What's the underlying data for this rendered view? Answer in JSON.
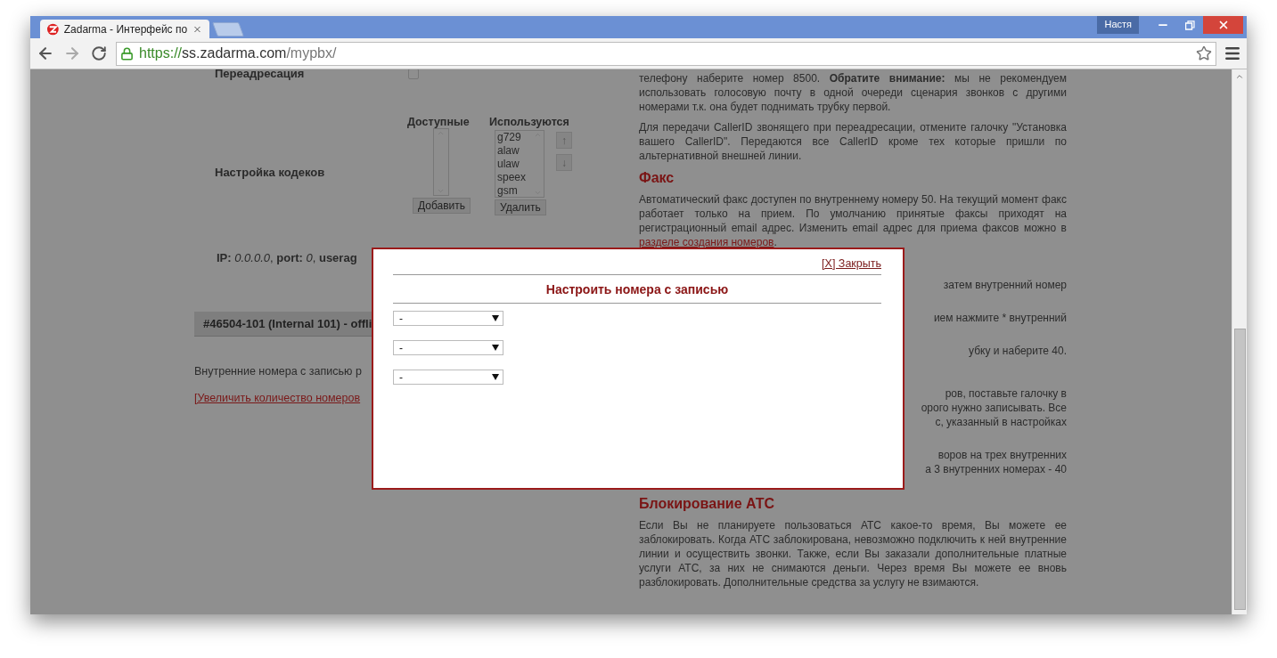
{
  "browser": {
    "tab_title": "Zadarma - Интерфейс по",
    "url_scheme": "https://",
    "url_host": "ss.zadarma.com",
    "url_path": "/mypbx/",
    "profile": "Настя"
  },
  "left": {
    "forwarding": {
      "label": "Переадресация",
      "checked": false
    },
    "codecs": {
      "label": "Настройка кодеков",
      "available_header": "Доступные",
      "used_header": "Используются",
      "used": [
        "g729",
        "alaw",
        "ulaw",
        "speex",
        "gsm"
      ],
      "add_button": "Добавить",
      "remove_button": "Удалить",
      "up_button": "↑",
      "down_button": "↓"
    },
    "ip_line": "**IP:** *0.0.0.0*, **port:** *0*, **userag**",
    "line_header": "#46504-101 (Internal 101) - offli",
    "note": "Внутренние номера с записью р",
    "link": "[Увеличить количество номеров"
  },
  "right": [
    {
      "kind": "text",
      "text": "телефону наберите номер 8500. **Обратите внимание:** мы не рекомендуем использовать голосовую почту в одной очереди сценария звонков с другими номерами т.к. она будет поднимать трубку первой."
    },
    {
      "kind": "text",
      "text": "Для передачи CallerID звонящего при переадресации, отмените галочку \"Установка вашего CallerID\". Передаются все CallerID кроме тех которые пришли по альтернативной внешней линии."
    },
    {
      "kind": "heading",
      "text": "Факс"
    },
    {
      "kind": "text",
      "text": "Автоматический факс доступен по внутреннему номеру 50. На текущий момент факс работает только на прием. По умолчанию принятые факсы приходят на регистрационный email адрес. Изменить email адрес для приема факсов можно в",
      "link": "разделе создания номеров",
      "after": "."
    },
    {
      "kind": "fragment",
      "lines": [
        "затем внутренний номер"
      ]
    },
    {
      "kind": "fragment",
      "lines": [
        "ием нажмите * внутренний"
      ]
    },
    {
      "kind": "fragment",
      "lines": [
        "убку и наберите 40."
      ]
    },
    {
      "kind": "fragment",
      "lines": [
        "ров, поставьте галочку в",
        "орого нужно записывать. Все",
        "с, указанный в настройках"
      ]
    },
    {
      "kind": "fragment",
      "lines": [
        "воров на трех внутренних",
        "а 3 внутренних номерах - 40"
      ]
    },
    {
      "kind": "heading",
      "text": "Блокирование АТС"
    },
    {
      "kind": "text",
      "text": "Если Вы не планируете пользоваться АТС какое-то время, Вы можете ее заблокировать. Когда АТС заблокирована, невозможно подключить к ней внутренние линии и осуществить звонки. Также, если Вы заказали дополнительные платные услуги АТС, за них не снимаются деньги. Через время Вы можете ее вновь разблокировать. Дополнительные средства за услугу не взимаются."
    }
  ],
  "modal": {
    "close": "[X] Закрыть",
    "title": "Настроить номера с записью",
    "selects": [
      {
        "value": "-"
      },
      {
        "value": "-"
      },
      {
        "value": "-"
      }
    ]
  }
}
